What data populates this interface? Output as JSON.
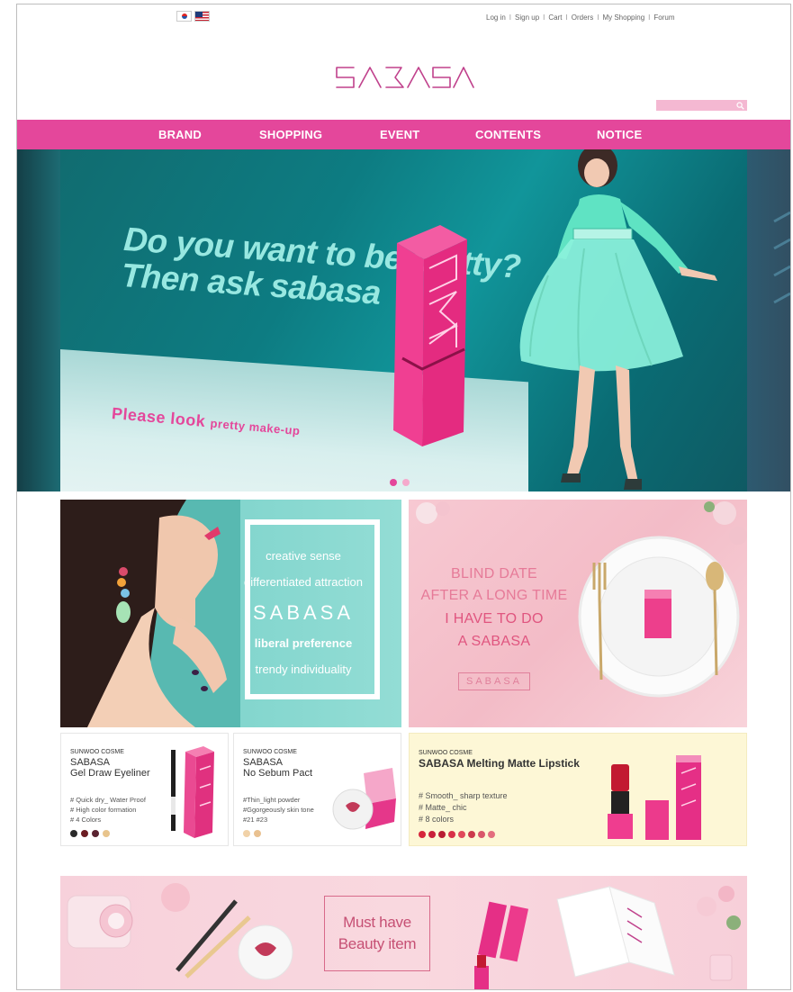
{
  "flags": [
    {
      "name": "korea-flag-icon"
    },
    {
      "name": "usa-flag-icon"
    }
  ],
  "toplinks": [
    "Log in",
    "Sign up",
    "Cart",
    "Orders",
    "My Shopping",
    "Forum"
  ],
  "toplinks_separator": "I",
  "logo_text": "SABASA",
  "search": {
    "placeholder": ""
  },
  "nav": [
    "BRAND",
    "SHOPPING",
    "EVENT",
    "CONTENTS",
    "NOTICE"
  ],
  "hero": {
    "line1": "Do you want to be pretty?",
    "line2": "Then ask sabasa",
    "tagline_a": "Please look ",
    "tagline_b": "pretty make-up",
    "slides": 2,
    "active_slide": 1
  },
  "promo_left": {
    "lines": [
      "creative sense",
      "differentiated attraction",
      "SABASA",
      "liberal preference",
      "trendy individuality"
    ]
  },
  "promo_right": {
    "lines": [
      "BLIND DATE",
      "AFTER A LONG TIME",
      "I HAVE TO DO",
      "A SABASA"
    ],
    "logo": "SABASA"
  },
  "products": [
    {
      "maker": "SUNWOO COSME",
      "brand": "SABASA",
      "name": "Gel Draw Eyeliner",
      "tags": [
        "# Quick dry_ Water Proof",
        "# High color formation",
        "# 4 Colors"
      ],
      "colors": [
        "#2a2a2a",
        "#6b1c22",
        "#5a2330",
        "#e8c48c"
      ]
    },
    {
      "maker": "SUNWOO COSME",
      "brand": "SABASA",
      "name": "No Sebum Pact",
      "tags": [
        "#Thin_light powder",
        "#Ggorgeously skin tone",
        "#21 #23"
      ],
      "colors": [
        "#f1d2a8",
        "#e9c190"
      ]
    },
    {
      "maker": "SUNWOO COSME",
      "name": "SABASA Melting Matte Lipstick",
      "tags": [
        "# Smooth_ sharp texture",
        "# Matte_ chic",
        "# 8 colors"
      ],
      "colors": [
        "#d6263b",
        "#c9203a",
        "#b81d33",
        "#d83047",
        "#e0495a",
        "#cc3a4c",
        "#d9566a",
        "#e36d7e"
      ]
    }
  ],
  "bottom_banner": {
    "line1": "Must have",
    "line2": "Beauty item"
  }
}
